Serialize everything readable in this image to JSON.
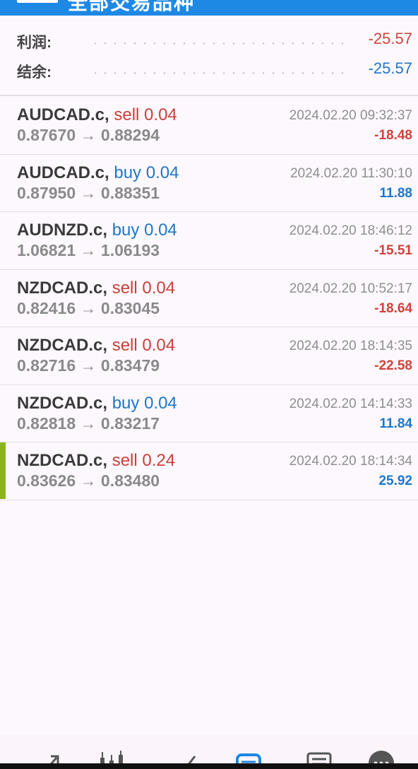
{
  "header": {
    "title": "全部交易品种"
  },
  "summary": {
    "profit_label": "利润:",
    "profit_value": "-25.57",
    "balance_label": "结余:",
    "balance_value": "-25.57"
  },
  "trades": [
    {
      "symbol": "AUDCAD.c,",
      "side": "sell",
      "volume": "0.04",
      "prices": "0.87670 → 0.88294",
      "time": "2024.02.20 09:32:37",
      "profit": "-18.48"
    },
    {
      "symbol": "AUDCAD.c,",
      "side": "buy",
      "volume": "0.04",
      "prices": "0.87950 → 0.88351",
      "time": "2024.02.20 11:30:10",
      "profit": "11.88"
    },
    {
      "symbol": "AUDNZD.c,",
      "side": "buy",
      "volume": "0.04",
      "prices": "1.06821 → 1.06193",
      "time": "2024.02.20 18:46:12",
      "profit": "-15.51"
    },
    {
      "symbol": "NZDCAD.c,",
      "side": "sell",
      "volume": "0.04",
      "prices": "0.82416 → 0.83045",
      "time": "2024.02.20 10:52:17",
      "profit": "-18.64"
    },
    {
      "symbol": "NZDCAD.c,",
      "side": "sell",
      "volume": "0.04",
      "prices": "0.82716 → 0.83479",
      "time": "2024.02.20 18:14:35",
      "profit": "-22.58"
    },
    {
      "symbol": "NZDCAD.c,",
      "side": "buy",
      "volume": "0.04",
      "prices": "0.82818 → 0.83217",
      "time": "2024.02.20 14:14:33",
      "profit": "11.84"
    },
    {
      "symbol": "NZDCAD.c,",
      "side": "sell",
      "volume": "0.24",
      "prices": "0.83626 → 0.83480",
      "time": "2024.02.20 18:14:34",
      "profit": "25.92"
    }
  ],
  "nav": [
    {
      "icon": "quotes-icon"
    },
    {
      "icon": "chart-candles-icon"
    },
    {
      "icon": "trend-line-icon"
    },
    {
      "icon": "trade-icon",
      "active": true
    },
    {
      "icon": "news-icon"
    },
    {
      "icon": "more-icon"
    }
  ],
  "colors": {
    "accent": "#1e88e5",
    "negative": "#d0423a",
    "positive": "#1e76c8",
    "active_marker": "#8ab61c"
  }
}
